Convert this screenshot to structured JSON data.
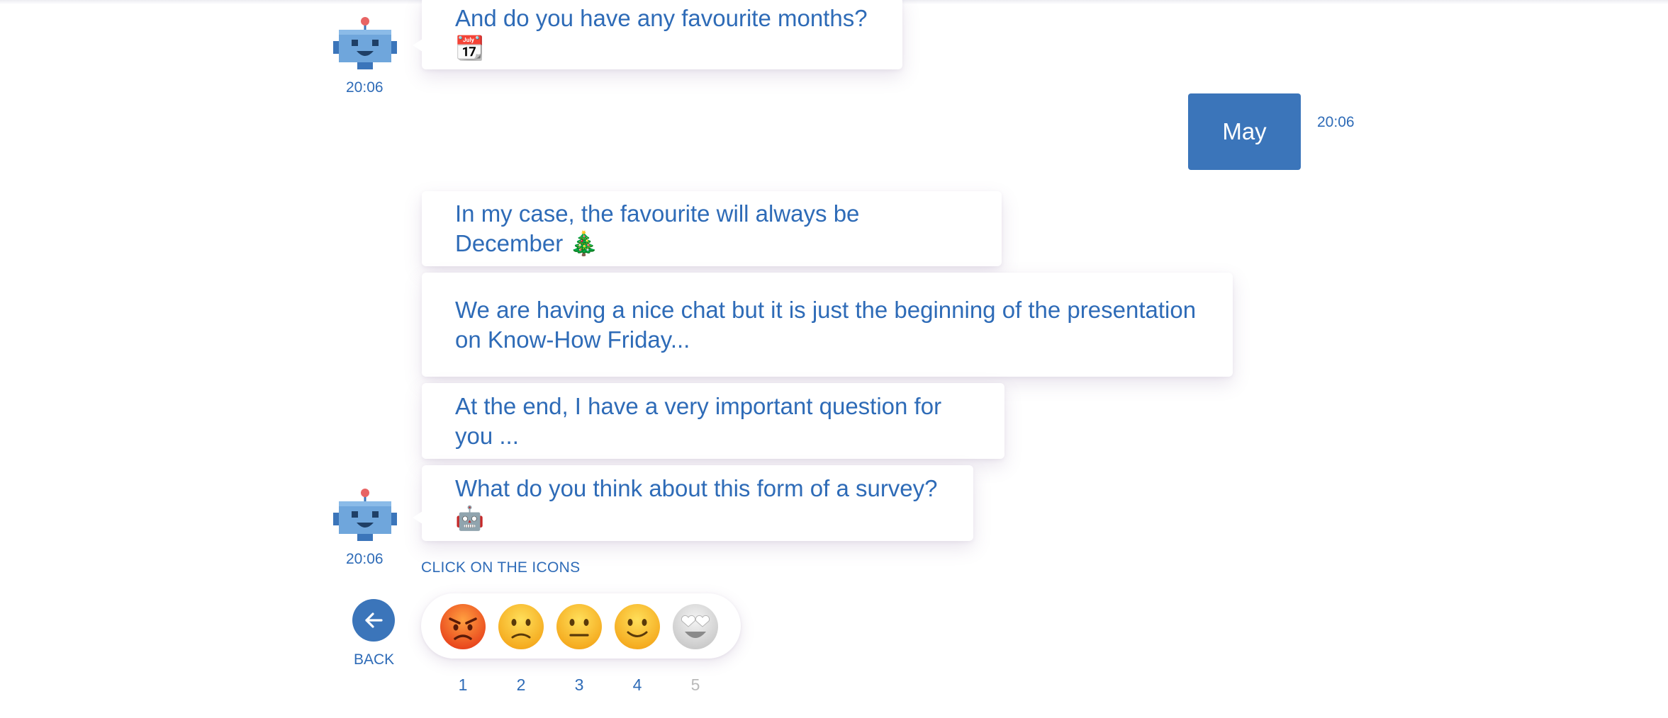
{
  "messages": [
    {
      "text": "And do you have any favourite months? 📆"
    },
    {
      "text": "In my case, the favourite will always be December 🎄"
    },
    {
      "text": "We are having a nice chat but it is just the beginning of the presentation on Know-How Friday..."
    },
    {
      "text": "At the end, I have a very important question for you ..."
    },
    {
      "text": "What do you think about this form of a survey? 🤖"
    }
  ],
  "bot_times": [
    "20:06",
    "20:06"
  ],
  "user_message": {
    "text": "May",
    "time": "20:06"
  },
  "survey": {
    "hint": "CLICK ON THE ICONS",
    "back_label": "BACK",
    "ratings": [
      {
        "number": "1",
        "icon": "angry-face-icon"
      },
      {
        "number": "2",
        "icon": "slightly-frowning-face-icon"
      },
      {
        "number": "3",
        "icon": "neutral-face-icon"
      },
      {
        "number": "4",
        "icon": "slightly-smiling-face-icon"
      },
      {
        "number": "5",
        "icon": "heart-eyes-face-icon"
      }
    ]
  },
  "colors": {
    "accent": "#3b75ba",
    "text": "#2e6bb7",
    "disabled": "#b9b9b9"
  }
}
